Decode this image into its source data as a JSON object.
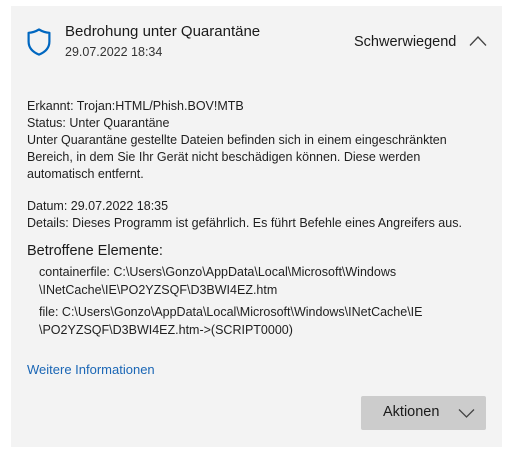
{
  "threat": {
    "title": "Bedrohung unter Quarantäne",
    "date": "29.07.2022 18:34",
    "severity": "Schwerwiegend",
    "icons": {
      "shield": "shield-icon",
      "collapse": "chevron-up-icon"
    }
  },
  "details": {
    "detected": "Erkannt:  Trojan:HTML/Phish.BOV!MTB",
    "status": "Status:  Unter Quarantäne",
    "description": "Unter Quarantäne gestellte Dateien befinden sich in einem eingeschränkten Bereich, in dem Sie Ihr Gerät nicht beschädigen können. Diese werden automatisch entfernt.",
    "date": "Datum:  29.07.2022 18:35",
    "info": "Details:  Dieses Programm ist gefährlich. Es führt Befehle eines Angreifers aus."
  },
  "affected": {
    "title": "Betroffene Elemente:",
    "item1_line1": "containerfile: C:\\Users\\Gonzo\\AppData\\Local\\Microsoft\\Windows",
    "item1_line2": "\\INetCache\\IE\\PO2YZSQF\\D3BWI4EZ.htm",
    "item2_line1": "file: C:\\Users\\Gonzo\\AppData\\Local\\Microsoft\\Windows\\INetCache\\IE",
    "item2_line2": "\\PO2YZSQF\\D3BWI4EZ.htm->(SCRIPT0000)"
  },
  "links": {
    "more_info": "Weitere Informationen"
  },
  "actions": {
    "label": "Aktionen",
    "icon": "chevron-down-icon"
  },
  "colors": {
    "card_bg": "#f3f3f3",
    "shield": "#0067c0",
    "link": "#1a66b5",
    "button_bg": "#cccccc"
  }
}
